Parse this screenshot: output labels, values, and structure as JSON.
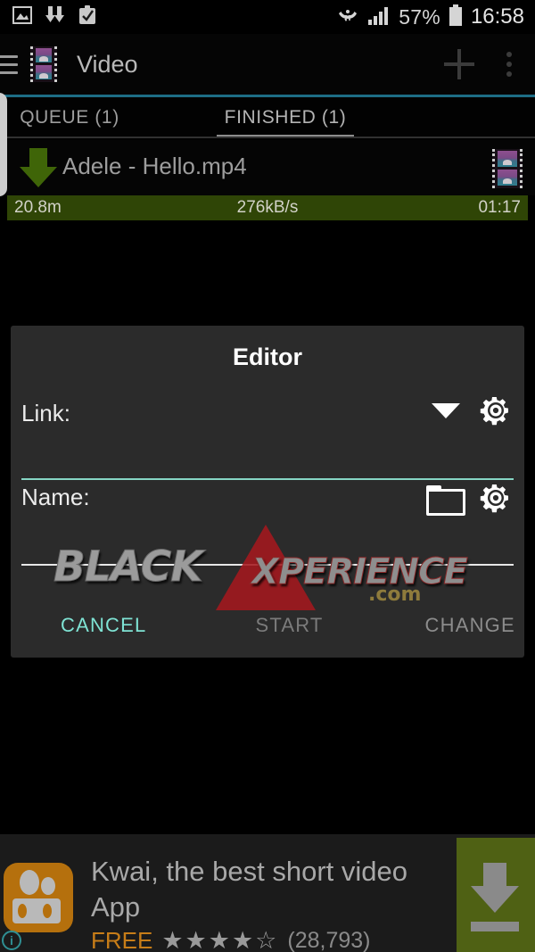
{
  "statusbar": {
    "icons_left": [
      "image-icon",
      "downloads-icon",
      "clipboard-check-icon"
    ],
    "wifi_icon": "wifi-icon",
    "signal_icon": "signal-bars-icon",
    "battery_percent": "57%",
    "battery_icon": "battery-icon",
    "time": "16:58"
  },
  "appbar": {
    "menu_icon": "hamburger-menu-icon",
    "app_icon": "filmstrip-icon",
    "title": "Video",
    "add_icon": "plus-icon",
    "overflow_icon": "overflow-menu-icon"
  },
  "tabs": [
    {
      "label": "QUEUE (1)",
      "selected": false
    },
    {
      "label": "FINISHED (1)",
      "selected": true
    }
  ],
  "download": {
    "arrow_icon": "download-arrow-icon",
    "name": "Adele - Hello.mp4",
    "thumb_icon": "filmstrip-icon",
    "progress": {
      "size": "20.8m",
      "speed": "276kB/s",
      "elapsed": "01:17",
      "bar_color": "#2f4506"
    }
  },
  "dialog": {
    "title": "Editor",
    "fields": [
      {
        "label": "Link:",
        "value": "",
        "icons": [
          "chevron-down-icon",
          "gear-icon"
        ],
        "rule_color": "#86d6c4"
      },
      {
        "label": "Name:",
        "value": "",
        "icons": [
          "folder-icon",
          "gear-icon"
        ],
        "rule_color": "#e8e8e8"
      }
    ],
    "actions": [
      {
        "label": "CANCEL",
        "enabled": true,
        "color": "#7fe3d4"
      },
      {
        "label": "START",
        "enabled": false,
        "color": "#7b7b7b"
      },
      {
        "label": "CHANGE",
        "enabled": false,
        "color": "#8c8c8c"
      }
    ]
  },
  "watermark": {
    "part1": "BLACK",
    "part2": "XPERIENCE",
    "part3": ".com"
  },
  "ad": {
    "icon": "kwai-app-icon",
    "info_badge": "i",
    "title": "Kwai, the best short video App",
    "price": "FREE",
    "stars": "★★★★☆",
    "rating_count": "(28,793)",
    "cta_icon": "download-arrow-icon",
    "cta_color": "#4f6114"
  }
}
